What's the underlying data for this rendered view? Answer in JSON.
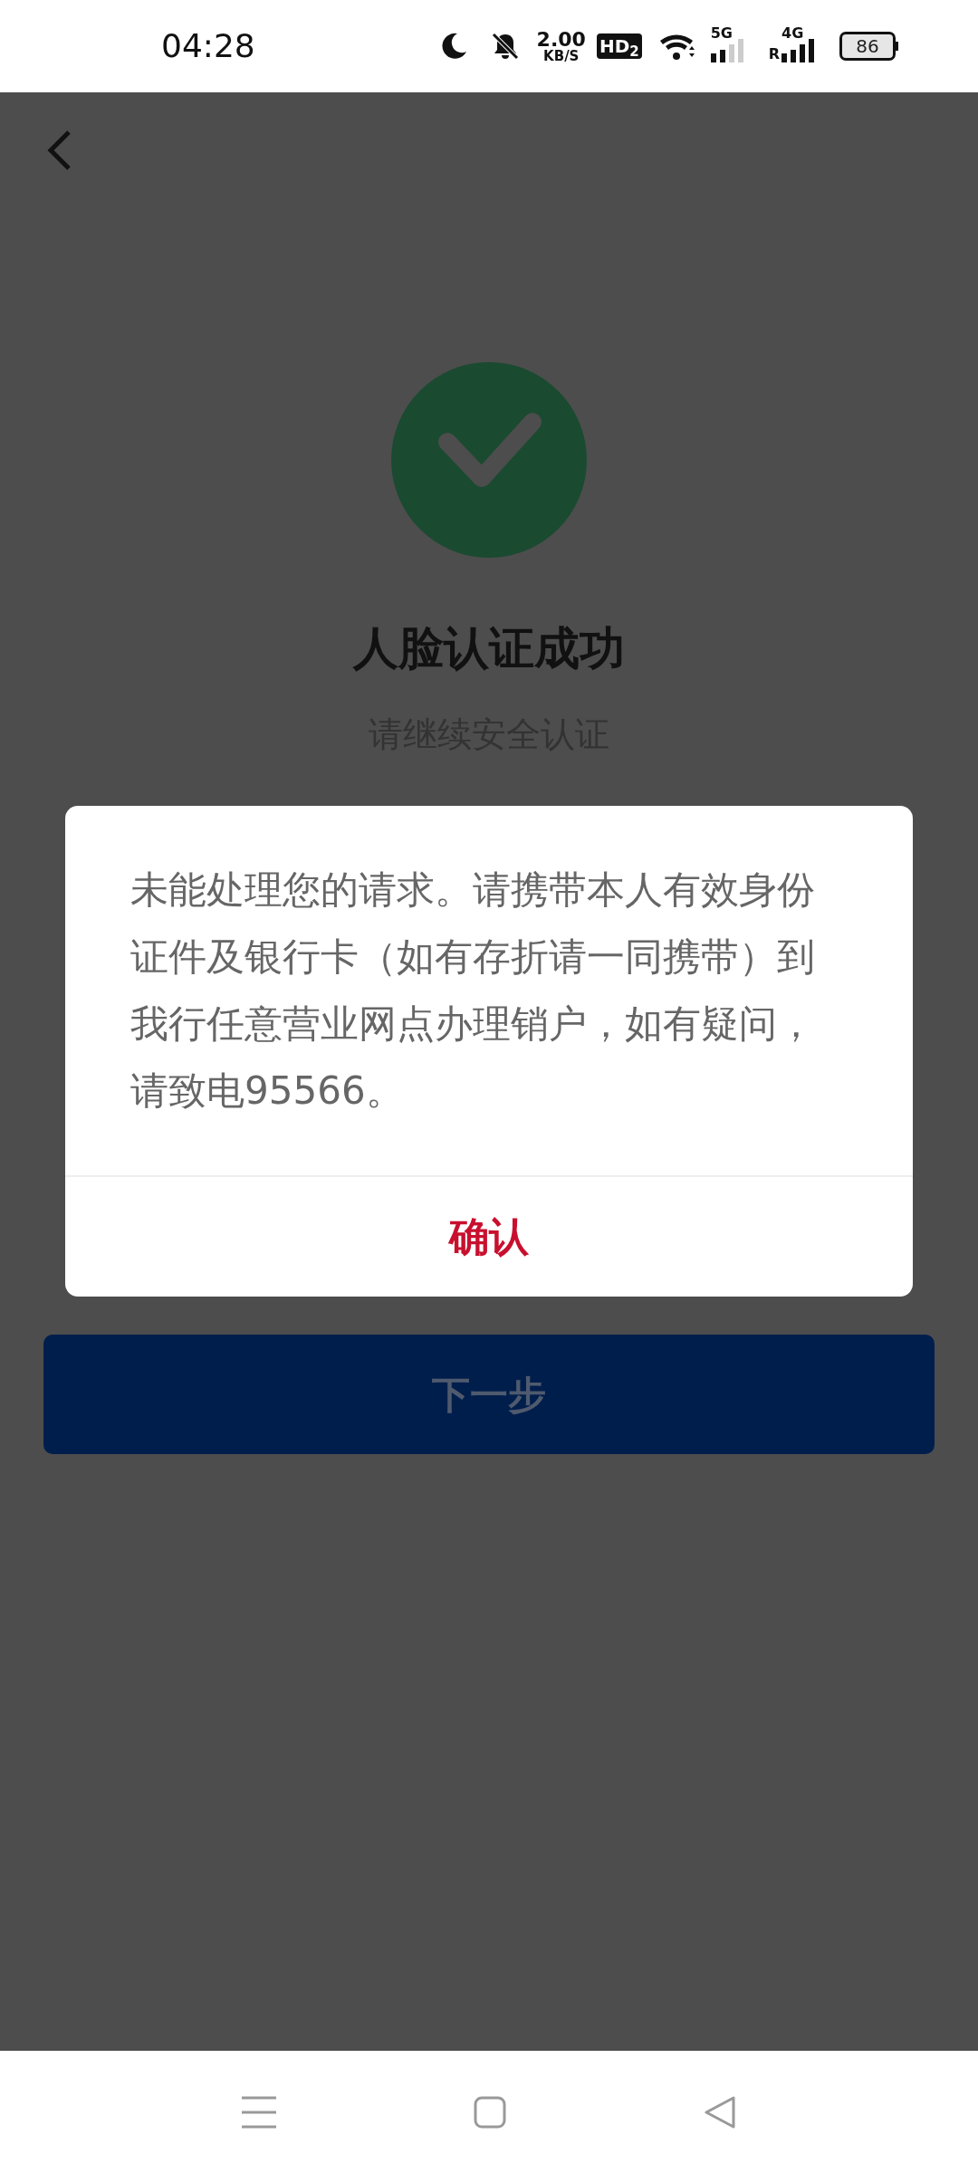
{
  "status_bar": {
    "time": "04:28",
    "network_speed": "2.00",
    "speed_unit": "KB/S",
    "hd_badge": "HD$_{2}$",
    "signal_1_label": "5G",
    "signal_2_label": "4G",
    "roaming": "R",
    "battery": "86"
  },
  "page": {
    "title": "人脸认证成功",
    "subtitle": "请继续安全认证",
    "next_button": "下一步"
  },
  "dialog": {
    "message": "未能处理您的请求。请携带本人有效身份证件及银行卡（如有存折请一同携带）到我行任意营业网点办理销户，如有疑问，请致电95566。",
    "confirm_button": "确认"
  }
}
